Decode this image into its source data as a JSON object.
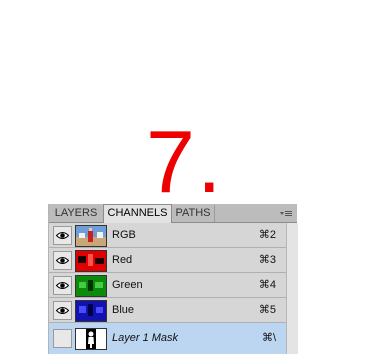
{
  "step": {
    "number": "7."
  },
  "panel": {
    "tabs": [
      {
        "label": "LAYERS",
        "active": false
      },
      {
        "label": "CHANNELS",
        "active": true
      },
      {
        "label": "PATHS",
        "active": false
      }
    ],
    "channels": [
      {
        "label": "RGB",
        "shortcut": "⌘2",
        "visible": true,
        "selected": false,
        "thumb": "rgb-thumbnail"
      },
      {
        "label": "Red",
        "shortcut": "⌘3",
        "visible": true,
        "selected": false,
        "thumb": "red-thumbnail"
      },
      {
        "label": "Green",
        "shortcut": "⌘4",
        "visible": true,
        "selected": false,
        "thumb": "green-thumbnail"
      },
      {
        "label": "Blue",
        "shortcut": "⌘5",
        "visible": true,
        "selected": false,
        "thumb": "blue-thumbnail"
      },
      {
        "label": "Layer 1 Mask",
        "shortcut": "⌘\\",
        "visible": false,
        "selected": true,
        "thumb": "mask-thumbnail"
      }
    ]
  },
  "colors": {
    "step_number": "#ee0000",
    "selected_row": "#bcd6f2",
    "red_channel": "#e00000",
    "green_channel": "#0c8a0c",
    "blue_channel": "#1212b0"
  },
  "icons": {
    "visibility": "eye-icon",
    "panel_menu": "panel-menu-icon"
  }
}
